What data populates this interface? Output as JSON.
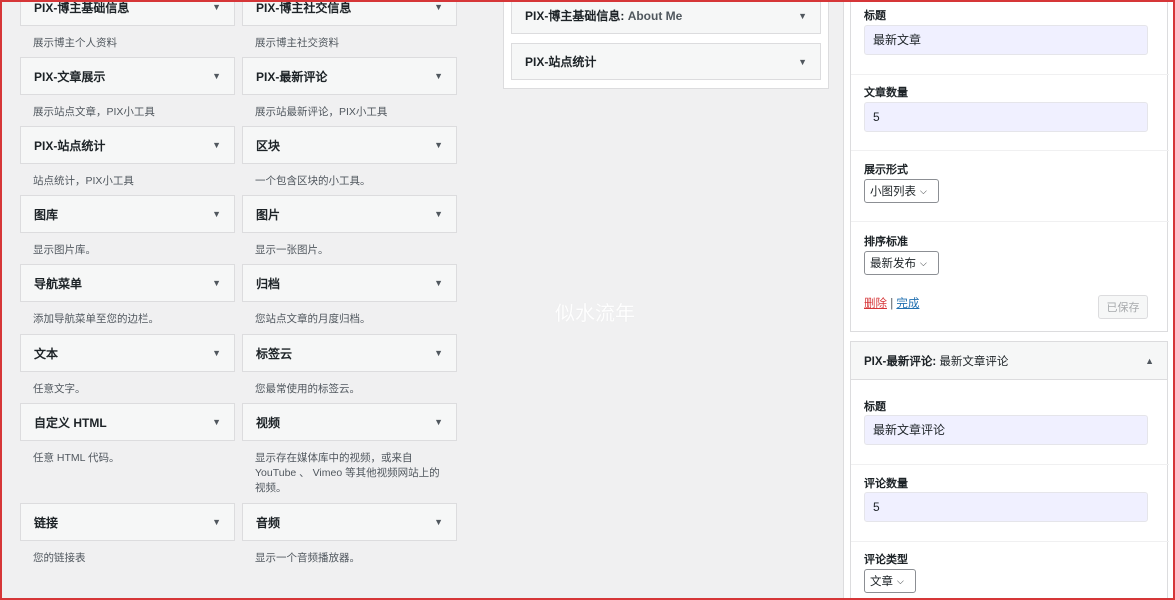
{
  "available_widgets": [
    {
      "label": "PIX-博主基础信息",
      "desc": "展示博主个人资料"
    },
    {
      "label": "PIX-博主社交信息",
      "desc": "展示博主社交资料"
    },
    {
      "label": "PIX-文章展示",
      "desc": "展示站点文章，PIX小工具"
    },
    {
      "label": "PIX-最新评论",
      "desc": "展示站最新评论，PIX小工具"
    },
    {
      "label": "PIX-站点统计",
      "desc": "站点统计，PIX小工具"
    },
    {
      "label": "区块",
      "desc": "一个包含区块的小工具。"
    },
    {
      "label": "图库",
      "desc": "显示图片库。"
    },
    {
      "label": "图片",
      "desc": "显示一张图片。"
    },
    {
      "label": "导航菜单",
      "desc": "添加导航菜单至您的边栏。"
    },
    {
      "label": "归档",
      "desc": "您站点文章的月度归档。"
    },
    {
      "label": "文本",
      "desc": "任意文字。"
    },
    {
      "label": "标签云",
      "desc": "您最常使用的标签云。"
    },
    {
      "label": "自定义 HTML",
      "desc": "任意 HTML 代码。"
    },
    {
      "label": "视频",
      "desc": "显示存在媒体库中的视频，或来自 YouTube 、 Vimeo 等其他视频网站上的视频。"
    },
    {
      "label": "链接",
      "desc": "您的链接表"
    },
    {
      "label": "音频",
      "desc": "显示一个音频播放器。"
    }
  ],
  "sidebar_area": {
    "widgets": [
      {
        "label": "PIX-博主基础信息:",
        "sub": "About Me"
      },
      {
        "label": "PIX-站点统计",
        "sub": ""
      }
    ]
  },
  "watermark": "似水流年",
  "posts_form": {
    "title_label": "标题",
    "title_value": "最新文章",
    "count_label": "文章数量",
    "count_value": "5",
    "display_label": "展示形式",
    "display_value": "小图列表",
    "sort_label": "排序标准",
    "sort_value": "最新发布",
    "delete_label": "删除",
    "separator": "|",
    "done_label": "完成",
    "saved_label": "已保存"
  },
  "comments_form": {
    "header_label": "PIX-最新评论:",
    "header_sub": "最新文章评论",
    "title_label": "标题",
    "title_value": "最新文章评论",
    "count_label": "评论数量",
    "count_value": "5",
    "type_label": "评论类型",
    "type_value": "文章"
  }
}
